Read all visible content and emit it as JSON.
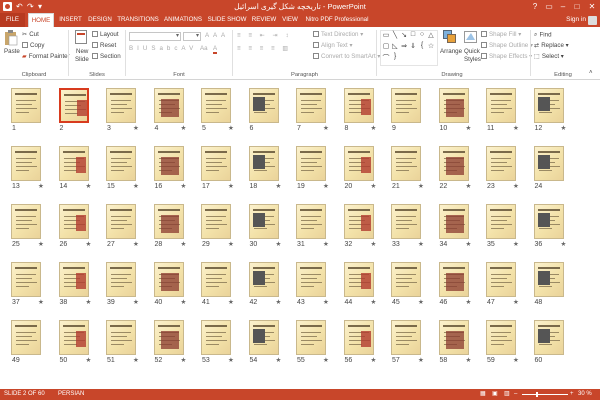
{
  "titlebar": {
    "title": "تاریخچه شکل گیری اسرائیل - PowerPoint",
    "qat": [
      "↶",
      "↷",
      "▾"
    ],
    "help": "?",
    "buttons": [
      "▭",
      "–",
      "□",
      "✕"
    ]
  },
  "tabs": [
    "FILE",
    "HOME",
    "INSERT",
    "DESIGN",
    "TRANSITIONS",
    "ANIMATIONS",
    "SLIDE SHOW",
    "REVIEW",
    "VIEW",
    "Nitro PDF Professional"
  ],
  "active_tab": "HOME",
  "signin": "Sign in",
  "ribbon": {
    "clipboard": {
      "label": "Clipboard",
      "paste": "Paste",
      "cut": "Cut",
      "copy": "Copy",
      "format_painter": "Format Painter"
    },
    "slides": {
      "label": "Slides",
      "new_slide": "New",
      "new_slide2": "Slide",
      "layout": "Layout",
      "reset": "Reset",
      "section": "Section"
    },
    "font": {
      "label": "Font"
    },
    "paragraph": {
      "label": "Paragraph",
      "text_direction": "Text Direction",
      "align_text": "Align Text",
      "convert_smartart": "Convert to SmartArt"
    },
    "drawing": {
      "label": "Drawing",
      "arrange": "Arrange",
      "quick_styles": "Quick",
      "quick_styles2": "Styles",
      "shape_fill": "Shape Fill",
      "shape_outline": "Shape Outline",
      "shape_effects": "Shape Effects"
    },
    "editing": {
      "label": "Editing",
      "find": "Find",
      "replace": "Replace",
      "select": "Select"
    }
  },
  "slides": [
    {
      "n": "1",
      "star": ""
    },
    {
      "n": "2",
      "star": ""
    },
    {
      "n": "3",
      "star": "★"
    },
    {
      "n": "4",
      "star": "★"
    },
    {
      "n": "5",
      "star": "★"
    },
    {
      "n": "6",
      "star": ""
    },
    {
      "n": "7",
      "star": "★"
    },
    {
      "n": "8",
      "star": "★"
    },
    {
      "n": "9",
      "star": ""
    },
    {
      "n": "10",
      "star": "★"
    },
    {
      "n": "11",
      "star": "★"
    },
    {
      "n": "12",
      "star": "★"
    },
    {
      "n": "13",
      "star": "★"
    },
    {
      "n": "14",
      "star": "★"
    },
    {
      "n": "15",
      "star": "★"
    },
    {
      "n": "16",
      "star": "★"
    },
    {
      "n": "17",
      "star": "★"
    },
    {
      "n": "18",
      "star": "★"
    },
    {
      "n": "19",
      "star": "★"
    },
    {
      "n": "20",
      "star": "★"
    },
    {
      "n": "21",
      "star": "★"
    },
    {
      "n": "22",
      "star": "★"
    },
    {
      "n": "23",
      "star": "★"
    },
    {
      "n": "24",
      "star": ""
    },
    {
      "n": "25",
      "star": "★"
    },
    {
      "n": "26",
      "star": "★"
    },
    {
      "n": "27",
      "star": "★"
    },
    {
      "n": "28",
      "star": "★"
    },
    {
      "n": "29",
      "star": "★"
    },
    {
      "n": "30",
      "star": "★"
    },
    {
      "n": "31",
      "star": "★"
    },
    {
      "n": "32",
      "star": "★"
    },
    {
      "n": "33",
      "star": "★"
    },
    {
      "n": "34",
      "star": "★"
    },
    {
      "n": "35",
      "star": "★"
    },
    {
      "n": "36",
      "star": "★"
    },
    {
      "n": "37",
      "star": "★"
    },
    {
      "n": "38",
      "star": "★"
    },
    {
      "n": "39",
      "star": "★"
    },
    {
      "n": "40",
      "star": "★"
    },
    {
      "n": "41",
      "star": "★"
    },
    {
      "n": "42",
      "star": "★"
    },
    {
      "n": "43",
      "star": "★"
    },
    {
      "n": "44",
      "star": "★"
    },
    {
      "n": "45",
      "star": "★"
    },
    {
      "n": "46",
      "star": "★"
    },
    {
      "n": "47",
      "star": "★"
    },
    {
      "n": "48",
      "star": ""
    },
    {
      "n": "49",
      "star": ""
    },
    {
      "n": "50",
      "star": "★"
    },
    {
      "n": "51",
      "star": "★"
    },
    {
      "n": "52",
      "star": "★"
    },
    {
      "n": "53",
      "star": "★"
    },
    {
      "n": "54",
      "star": "★"
    },
    {
      "n": "55",
      "star": "★"
    },
    {
      "n": "56",
      "star": "★"
    },
    {
      "n": "57",
      "star": "★"
    },
    {
      "n": "58",
      "star": "★"
    },
    {
      "n": "59",
      "star": "★"
    },
    {
      "n": "60",
      "star": ""
    }
  ],
  "selected_slide": "2",
  "status": {
    "slide": "SLIDE 2 OF 60",
    "language": "PERSIAN",
    "zoom": "30 %",
    "zoom_percent": 30
  },
  "colors": {
    "accent": "#c8462a",
    "slide_bg": "#f3e2a9",
    "selected_border": "#d83b1e"
  }
}
